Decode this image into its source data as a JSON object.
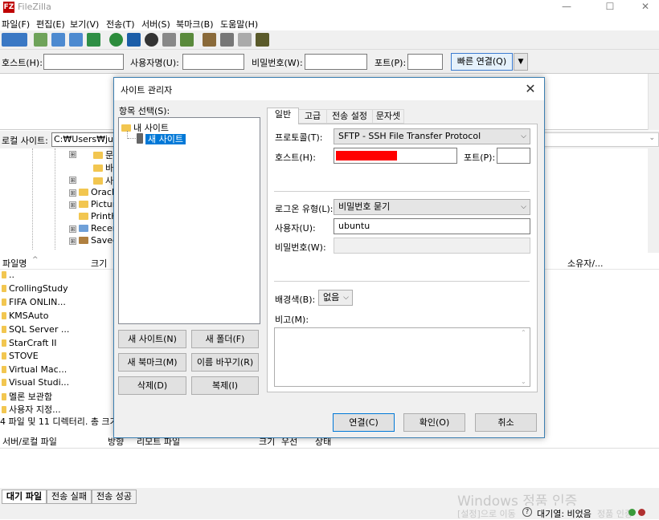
{
  "app": {
    "title": "FileZilla",
    "icon_letter": "FZ"
  },
  "menu": [
    "파일(F)",
    "편집(E)",
    "보기(V)",
    "전송(T)",
    "서버(S)",
    "북마크(B)",
    "도움말(H)"
  ],
  "quickconnect": {
    "host_label": "호스트(H):",
    "user_label": "사용자명(U):",
    "pass_label": "비밀번호(W):",
    "port_label": "포트(P):",
    "connect_label": "빠른 연결(Q)",
    "dropdown_glyph": "▼"
  },
  "local": {
    "site_label": "로컬 사이트:",
    "path_value": "C:₩Users₩justi₩",
    "tree": [
      {
        "label": "문",
        "expander": "⊞"
      },
      {
        "label": "바",
        "expander": ""
      },
      {
        "label": "사",
        "expander": "⊞"
      },
      {
        "label": "Oracle",
        "expander": "⊞"
      },
      {
        "label": "Pictur",
        "expander": "⊞"
      },
      {
        "label": "PrintH",
        "expander": ""
      },
      {
        "label": "Recen",
        "expander": "⊞"
      },
      {
        "label": "Saved",
        "expander": "⊞"
      }
    ],
    "col_filename": "파일명",
    "col_size": "크기",
    "col_owner": "소유자/...",
    "files": [
      "..",
      "CrollingStudy",
      "FIFA ONLIN...",
      "KMSAuto",
      "SQL Server ...",
      "StarCraft II",
      "STOVE",
      "Virtual Mac...",
      "Visual Studi...",
      "멜론 보관함",
      "사용자 지정..."
    ],
    "status": "4 파일 및 11 디렉터리. 총 크기"
  },
  "queue": {
    "col_server_file": "서버/로컬 파일",
    "col_direction": "방향",
    "col_remote_file": "리모트 파일",
    "col_size": "크기",
    "col_priority": "우선",
    "col_status": "상태"
  },
  "bottom_tabs": [
    "대기 파일",
    "전송 실패",
    "전송 성공"
  ],
  "statusbar": {
    "watermark_1": "Windows 정품 인증",
    "watermark_2": "[설정]으로 이동",
    "queue_text": "대기열: 비었음",
    "watermark_3": "정품 인증"
  },
  "dialog": {
    "title": "사이트 관리자",
    "close_glyph": "✕",
    "select_label": "항목 선택(S):",
    "tree_root": "내 사이트",
    "tree_child": "새 사이트",
    "buttons": {
      "new_site": "새 사이트(N)",
      "new_folder": "새 폴더(F)",
      "new_bookmark": "새 북마크(M)",
      "rename": "이름 바꾸기(R)",
      "delete": "삭제(D)",
      "copy": "복제(I)",
      "connect": "연결(C)",
      "ok": "확인(O)",
      "cancel": "취소"
    },
    "tabs": [
      "일반",
      "고급",
      "전송 설정",
      "문자셋"
    ],
    "general": {
      "protocol_label": "프로토콜(T):",
      "protocol_value": "SFTP - SSH File Transfer Protocol",
      "host_label": "호스트(H):",
      "port_label": "포트(P):",
      "logon_label": "로그온 유형(L):",
      "logon_value": "비밀번호 묻기",
      "user_label": "사용자(U):",
      "user_value": "ubuntu",
      "pass_label": "비밀번호(W):",
      "bgcolor_label": "배경색(B):",
      "bgcolor_value": "없음",
      "comments_label": "비고(M):"
    }
  }
}
